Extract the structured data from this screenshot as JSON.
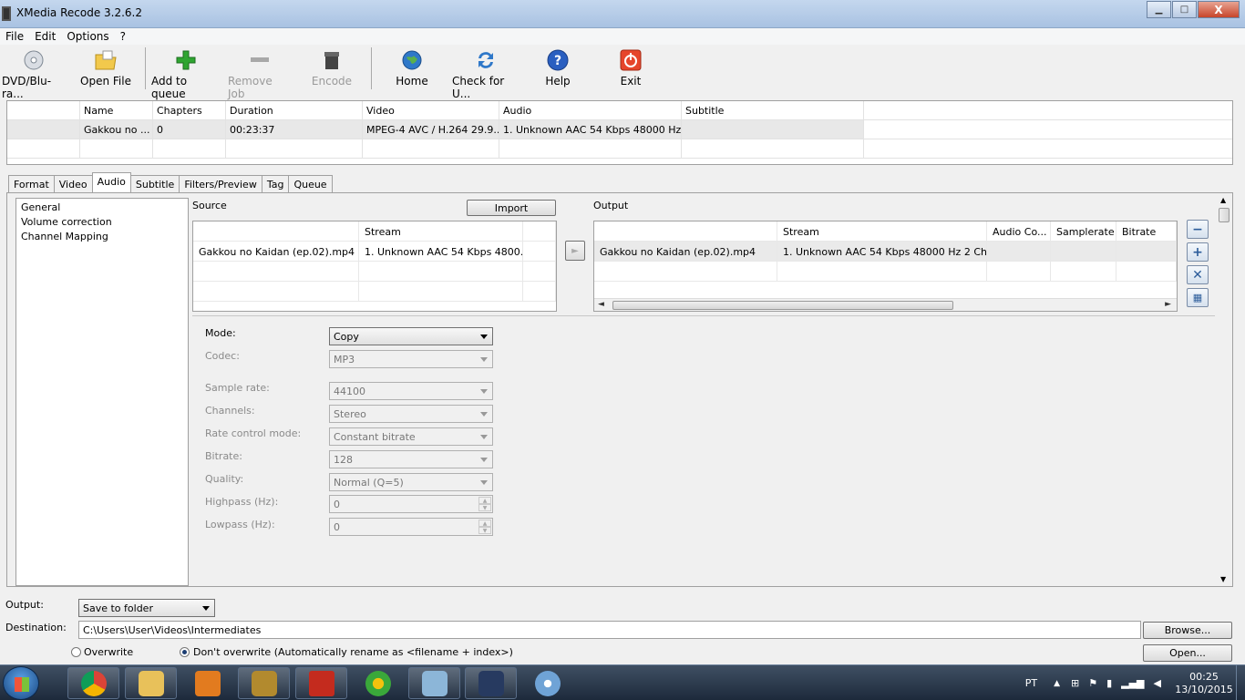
{
  "window": {
    "title": "XMedia Recode 3.2.6.2",
    "min": "▁",
    "max": "□",
    "close": "X"
  },
  "menu": [
    "File",
    "Edit",
    "Options",
    "?"
  ],
  "toolbar": {
    "dvd": "DVD/Blu-ra...",
    "open_file": "Open File",
    "add_queue": "Add to queue",
    "remove_job": "Remove Job",
    "encode": "Encode",
    "home": "Home",
    "check": "Check for U...",
    "help": "Help",
    "exit": "Exit"
  },
  "filelist": {
    "headers": [
      "Name",
      "Chapters",
      "Duration",
      "Video",
      "Audio",
      "Subtitle"
    ],
    "rows": [
      [
        "Gakkou no ...",
        "0",
        "00:23:37",
        "MPEG-4 AVC / H.264 29.9...",
        "1. Unknown AAC  54 Kbps 48000 Hz ...",
        ""
      ]
    ]
  },
  "tabs": [
    "Format",
    "Video",
    "Audio",
    "Subtitle",
    "Filters/Preview",
    "Tag",
    "Queue"
  ],
  "tree": [
    "General",
    "Volume correction",
    "Channel Mapping"
  ],
  "source": {
    "label": "Source",
    "import": "Import",
    "header_stream": "Stream",
    "file": "Gakkou no Kaidan (ep.02).mp4",
    "stream": "1. Unknown AAC  54 Kbps 4800..."
  },
  "output_grid": {
    "label": "Output",
    "headers": [
      "",
      "Stream",
      "Audio Co...",
      "Samplerate",
      "Bitrate"
    ],
    "file": "Gakkou no Kaidan (ep.02).mp4",
    "stream": "1. Unknown AAC  54 Kbps 48000 Hz 2 Cha..."
  },
  "settings": {
    "mode": {
      "label": "Mode:",
      "value": "Copy"
    },
    "codec": {
      "label": "Codec:",
      "value": "MP3"
    },
    "sample_rate": {
      "label": "Sample rate:",
      "value": "44100"
    },
    "channels": {
      "label": "Channels:",
      "value": "Stereo"
    },
    "rate_control": {
      "label": "Rate control mode:",
      "value": "Constant bitrate"
    },
    "bitrate": {
      "label": "Bitrate:",
      "value": "128"
    },
    "quality": {
      "label": "Quality:",
      "value": "Normal (Q=5)"
    },
    "highpass": {
      "label": "Highpass (Hz):",
      "value": "0"
    },
    "lowpass": {
      "label": "Lowpass (Hz):",
      "value": "0"
    }
  },
  "bottom": {
    "output_label": "Output:",
    "output_value": "Save to folder",
    "destination_label": "Destination:",
    "destination_value": "C:\\Users\\User\\Videos\\Intermediates",
    "browse": "Browse...",
    "overwrite": "Overwrite",
    "dont_overwrite": "Don't overwrite (Automatically rename as <filename + index>)",
    "open": "Open..."
  },
  "taskbar": {
    "lang": "PT",
    "time": "00:25",
    "date": "13/10/2015"
  }
}
